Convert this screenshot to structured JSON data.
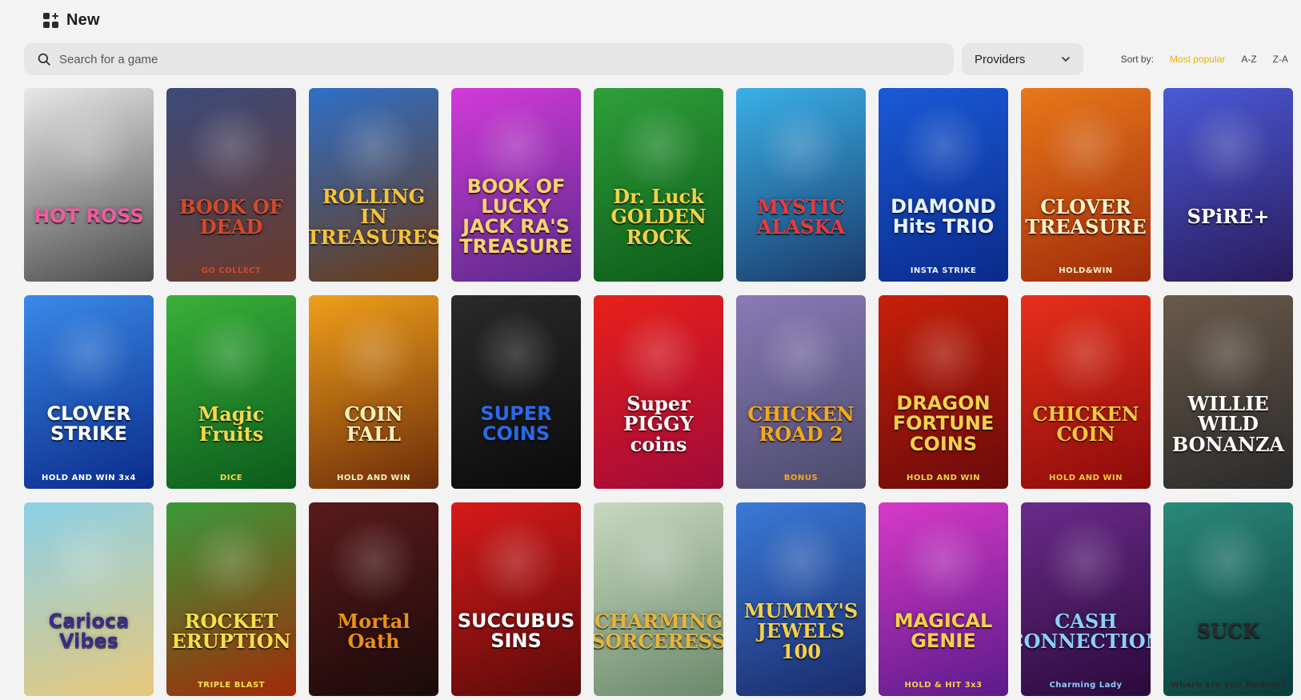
{
  "header": {
    "title": "New"
  },
  "search": {
    "placeholder": "Search for a game"
  },
  "providers": {
    "label": "Providers"
  },
  "sort": {
    "label": "Sort by:",
    "options": [
      "Most popular",
      "A-Z",
      "Z-A"
    ],
    "active": "Most popular"
  },
  "colors": {
    "accent": "#e8b400",
    "background": "#f3f3f3",
    "field": "#e6e6e6"
  },
  "games": [
    {
      "title": "HOT ROSS",
      "color1": "#e8e8e8",
      "color2": "#4a4a4a",
      "text": "#f05aa0"
    },
    {
      "title": "BOOK OF DEAD",
      "sub": "GO COLLECT",
      "color1": "#3c4a7a",
      "color2": "#6a3a2a",
      "text": "#d24a2a"
    },
    {
      "title": "ROLLING IN TREASURES",
      "color1": "#2f6fc8",
      "color2": "#6a3a14",
      "text": "#f5c23a"
    },
    {
      "title": "BOOK OF LUCKY JACK RA'S TREASURE",
      "color1": "#d23ad8",
      "color2": "#5a2a8a",
      "text": "#f7d46a"
    },
    {
      "title": "Dr. Luck GOLDEN ROCK",
      "color1": "#2fa03a",
      "color2": "#0c5a18",
      "text": "#f5d04a"
    },
    {
      "title": "MYSTIC ALASKA",
      "color1": "#3ab0e8",
      "color2": "#1a3a6a",
      "text": "#e83a3a"
    },
    {
      "title": "DIAMOND Hits TRIO",
      "sub": "INSTA STRIKE",
      "color1": "#1a5ad8",
      "color2": "#0a2a8a",
      "text": "#e8f2ff"
    },
    {
      "title": "CLOVER TREASURE",
      "sub": "HOLD&WIN",
      "color1": "#e8781a",
      "color2": "#a02a0a",
      "text": "#fff2c8"
    },
    {
      "title": "SPiRE+",
      "color1": "#4a5ad8",
      "color2": "#2a1a5a",
      "text": "#ffffff"
    },
    {
      "title": "CLOVER STRIKE",
      "sub": "HOLD AND WIN 3x4",
      "color1": "#3a8ae8",
      "color2": "#0a2a8a",
      "text": "#ffffff"
    },
    {
      "title": "Magic Fruits",
      "sub": "DICE",
      "color1": "#3ab03a",
      "color2": "#0a5a1a",
      "text": "#f5d84a"
    },
    {
      "title": "COIN FALL",
      "sub": "HOLD AND WIN",
      "color1": "#f0a01a",
      "color2": "#6a2a0a",
      "text": "#fff2b8"
    },
    {
      "title": "SUPER COINS",
      "color1": "#2a2a2a",
      "color2": "#0a0a0a",
      "text": "#2a6ae8"
    },
    {
      "title": "Super PIGGY coins",
      "color1": "#e8201a",
      "color2": "#a00a3a",
      "text": "#ffffff"
    },
    {
      "title": "CHICKEN ROAD 2",
      "sub": "BONUS",
      "color1": "#8a7ab8",
      "color2": "#4a4a6a",
      "text": "#f5a81a"
    },
    {
      "title": "DRAGON FORTUNE COINS",
      "sub": "HOLD AND WIN",
      "color1": "#c8200a",
      "color2": "#6a0a0a",
      "text": "#f5d04a"
    },
    {
      "title": "CHICKEN COIN",
      "sub": "HOLD AND WIN",
      "color1": "#e8301a",
      "color2": "#8a0a0a",
      "text": "#f5c83a"
    },
    {
      "title": "WILLIE WILD BONANZA",
      "color1": "#6a5a4a",
      "color2": "#2a2a2a",
      "text": "#ffffff"
    },
    {
      "title": "Carioca Vibes",
      "color1": "#8ad0e8",
      "color2": "#e8c87a",
      "text": "#3a2a8a"
    },
    {
      "title": "ROCKET ERUPTION",
      "sub": "TRIPLE BLAST",
      "color1": "#3a9a3a",
      "color2": "#a02a0a",
      "text": "#f5e04a"
    },
    {
      "title": "Mortal Oath",
      "color1": "#5a1a1a",
      "color2": "#1a0a0a",
      "text": "#e8901a"
    },
    {
      "title": "SUCCUBUS SINS",
      "color1": "#d81a1a",
      "color2": "#5a0a0a",
      "text": "#ffffff"
    },
    {
      "title": "CHARMING SORCERESS",
      "color1": "#c8d8c0",
      "color2": "#6a8a6a",
      "text": "#e8b43a"
    },
    {
      "title": "MUMMY'S JEWELS 100",
      "color1": "#3a7ad8",
      "color2": "#1a2a6a",
      "text": "#f5d04a"
    },
    {
      "title": "MAGICAL GENIE",
      "sub": "HOLD & HIT 3x3",
      "color1": "#d83ac8",
      "color2": "#5a1a8a",
      "text": "#f5d04a"
    },
    {
      "title": "CASH CONNECTION",
      "sub": "Charming Lady",
      "color1": "#6a2a8a",
      "color2": "#2a0a3a",
      "text": "#8ad0ff"
    },
    {
      "title": "SUCK",
      "sub": "Where are you Tucker?!",
      "color1": "#2a8a7a",
      "color2": "#0a3a3a",
      "text": "#2a2a2a"
    }
  ]
}
